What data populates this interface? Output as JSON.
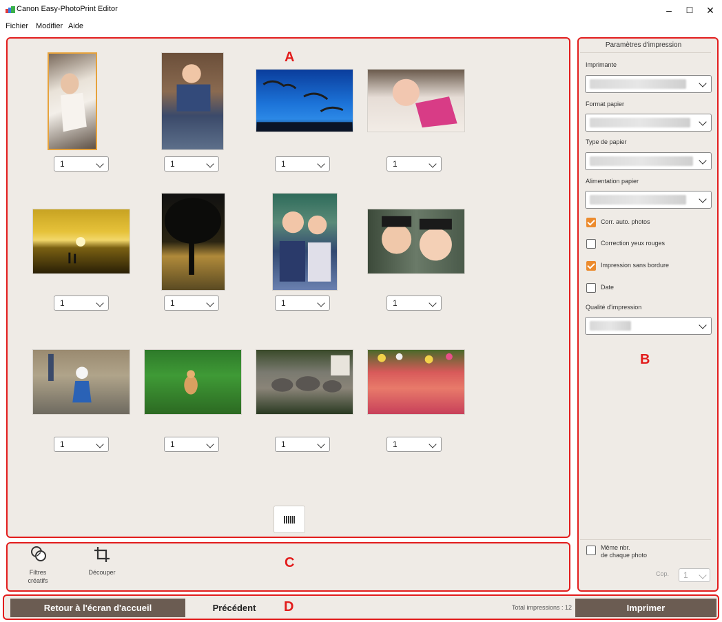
{
  "window": {
    "title": "Canon Easy-PhotoPrint Editor",
    "minimize": "–",
    "maximize": "☐",
    "close": "✕"
  },
  "menu": [
    "Fichier",
    "Modifier",
    "Aide"
  ],
  "regions": {
    "a": "A",
    "b": "B",
    "c": "C",
    "d": "D"
  },
  "photos": {
    "p1": {
      "copies": "1"
    },
    "p2": {
      "copies": "1"
    },
    "p3": {
      "copies": "1"
    },
    "p4": {
      "copies": "1"
    },
    "p5": {
      "copies": "1"
    },
    "p6": {
      "copies": "1"
    },
    "p7": {
      "copies": "1"
    },
    "p8": {
      "copies": "1"
    },
    "p9": {
      "copies": "1"
    },
    "p10": {
      "copies": "1"
    },
    "p11": {
      "copies": "1"
    },
    "p12": {
      "copies": "1"
    }
  },
  "settings": {
    "title": "Paramètres d'impression",
    "printer_label": "Imprimante",
    "paper_size_label": "Format papier",
    "paper_type_label": "Type de papier",
    "paper_source_label": "Alimentation papier",
    "auto_correct": {
      "label": "Corr. auto. photos",
      "checked": true
    },
    "red_eye": {
      "label": "Correction yeux rouges",
      "checked": false
    },
    "borderless": {
      "label": "Impression sans bordure",
      "checked": true
    },
    "date": {
      "label": "Date",
      "checked": false
    },
    "quality_label": "Qualité d'impression",
    "same_count": {
      "line1": "Même nbr.",
      "line2": "de chaque photo",
      "checked": false
    },
    "copies_label": "Cop.",
    "copies_value": "1"
  },
  "tools": {
    "filters": {
      "line1": "Filtres",
      "line2": "créatifs",
      "icon": "filters-icon"
    },
    "crop": {
      "label": "Découper",
      "icon": "crop-icon"
    }
  },
  "footer": {
    "home": "Retour à l'écran d'accueil",
    "previous": "Précédent",
    "total": "Total impressions : 12",
    "print": "Imprimer"
  }
}
